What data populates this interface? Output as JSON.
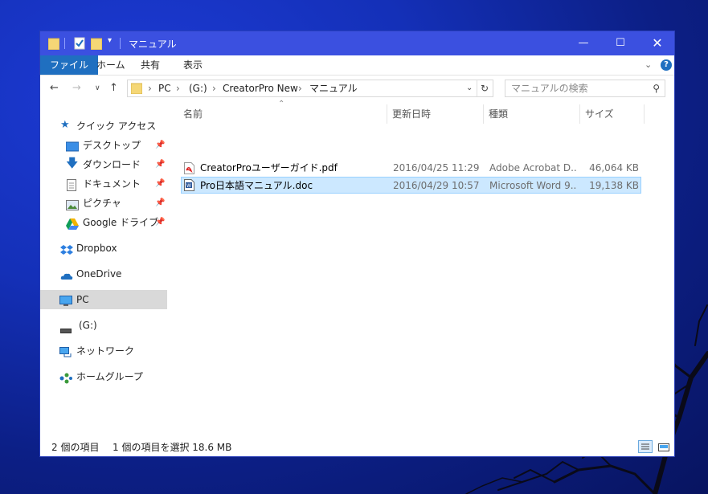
{
  "window": {
    "title": "マニュアル"
  },
  "ribbon": {
    "tabs": [
      "ファイル",
      "ホーム",
      "共有",
      "表示"
    ]
  },
  "address": {
    "segments": [
      "PC",
      "(G:)",
      "CreatorPro New",
      "マニュアル"
    ],
    "search_placeholder": "マニュアルの検索"
  },
  "sidebar": {
    "quick_access": "クイック アクセス",
    "pinned": [
      "デスクトップ",
      "ダウンロード",
      "ドキュメント",
      "ピクチャ",
      "Google ドライブ"
    ],
    "dropbox": "Dropbox",
    "onedrive": "OneDrive",
    "pc": "PC",
    "drive_g": "(G:)",
    "network": "ネットワーク",
    "homegroup": "ホームグループ"
  },
  "columns": [
    "名前",
    "更新日時",
    "種類",
    "サイズ"
  ],
  "files": [
    {
      "name": "CreatorProユーザーガイド.pdf",
      "modified": "2016/04/25 11:29",
      "type": "Adobe Acrobat D...",
      "size": "46,064 KB"
    },
    {
      "name": "Pro日本語マニュアル.doc",
      "modified": "2016/04/29 10:57",
      "type": "Microsoft Word 9...",
      "size": "19,138 KB"
    }
  ],
  "status": {
    "item_count": "2 個の項目",
    "selection": "1 個の項目を選択  18.6 MB"
  },
  "colors": {
    "titlebar": "#3b50e0",
    "accent": "#1f6fc0",
    "selection": "#cce8ff"
  }
}
